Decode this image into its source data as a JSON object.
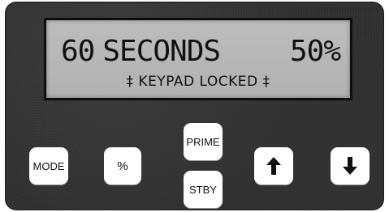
{
  "display": {
    "time_value": "60",
    "time_unit": "SECONDS",
    "percent": "50%",
    "status": "‡ KEYPAD LOCKED ‡"
  },
  "buttons": {
    "mode_label": "MODE",
    "percent_label": "%",
    "prime_label": "PRIME",
    "stby_label": "STBY",
    "up_icon": "arrow-up-icon",
    "down_icon": "arrow-down-icon"
  },
  "colors": {
    "panel": "#333333",
    "lcd_background": "#b8b8b8",
    "lcd_text": "#111111",
    "button": "#ffffff"
  }
}
